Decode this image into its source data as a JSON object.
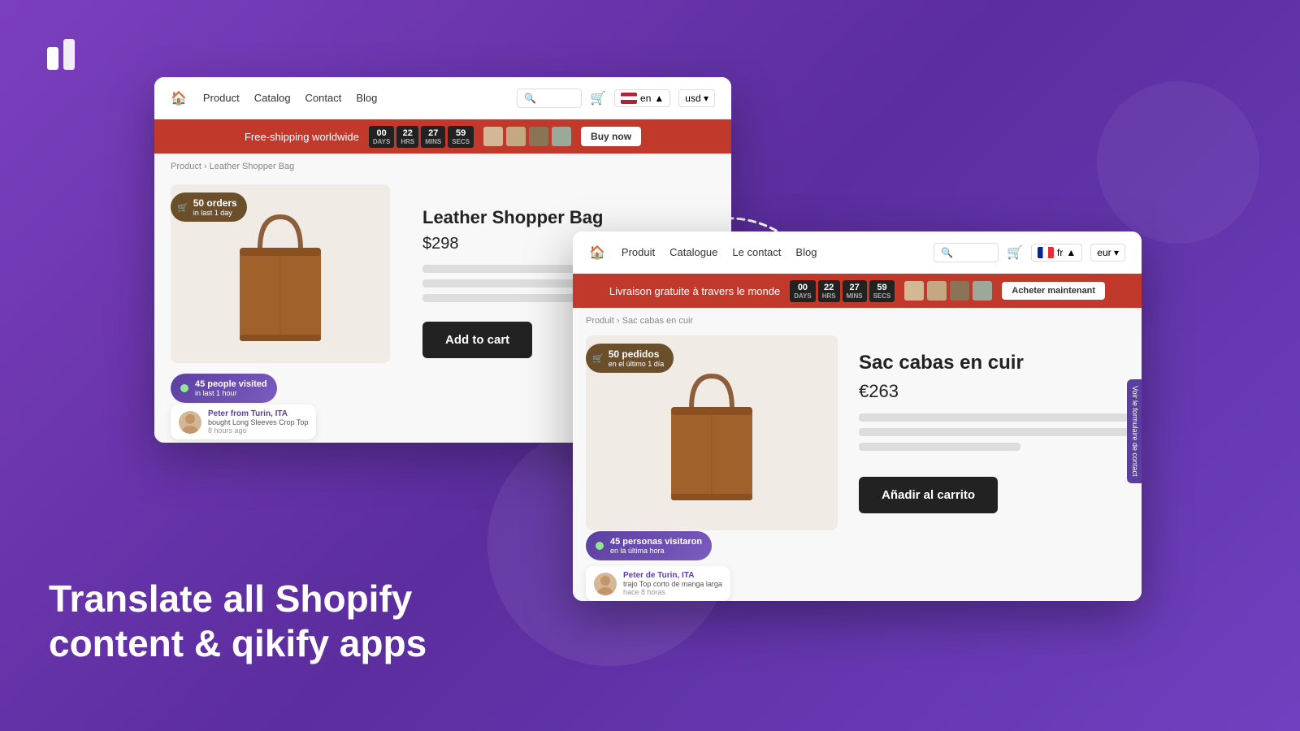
{
  "logo": {
    "alt": "qikify logo"
  },
  "headline": {
    "line1": "Translate all Shopify",
    "line2": "content & qikify apps"
  },
  "arrow": {
    "label": "dashed arrow"
  },
  "window_en": {
    "nav": {
      "home_icon": "🏠",
      "links": [
        "Product",
        "Catalog",
        "Contact",
        "Blog"
      ],
      "search_placeholder": "Search",
      "cart_icon": "🛒",
      "lang": "en",
      "currency": "usd"
    },
    "promo": {
      "text": "Free-shipping worldwide",
      "countdown": {
        "days": "00",
        "hours": "22",
        "mins": "27",
        "secs": "59"
      },
      "buy_label": "Buy now"
    },
    "breadcrumb": "Product › Leather Shopper Bag",
    "product": {
      "title": "Leather Shopper Bag",
      "price": "$298",
      "add_to_cart": "Add to cart"
    },
    "badges": {
      "orders": {
        "count": "50 orders",
        "sub": "in last 1 day"
      },
      "visitors": {
        "count": "45 people visited",
        "sub": "in last 1 hour"
      },
      "recent": {
        "name": "Peter from Turin, ITA",
        "action": "bought Long Sleeves Crop Top",
        "time": "8 hours ago"
      }
    }
  },
  "window_fr": {
    "nav": {
      "home_icon": "🏠",
      "links": [
        "Produit",
        "Catalogue",
        "Le contact",
        "Blog"
      ],
      "search_placeholder": "Rechercher",
      "cart_icon": "🛒",
      "lang": "fr",
      "currency": "eur"
    },
    "promo": {
      "text": "Livraison gratuite à travers le monde",
      "countdown": {
        "days": "00",
        "hours": "22",
        "mins": "27",
        "secs": "59"
      },
      "buy_label": "Acheter maintenant"
    },
    "breadcrumb": "Produit › Sac cabas en cuir",
    "product": {
      "title": "Sac cabas en cuir",
      "price": "€263",
      "add_to_cart": "Añadir al carrito"
    },
    "badges": {
      "orders": {
        "count": "50 pedidos",
        "sub": "en el último 1 día"
      },
      "visitors": {
        "count": "45 personas visitaron",
        "sub": "en la última hora"
      },
      "recent": {
        "name": "Peter de Turin, ITA",
        "action": "trajo Top corto de manga larga",
        "time": "hace 8 horas"
      }
    }
  },
  "contact_tab": "Voir le formulaire de contact"
}
